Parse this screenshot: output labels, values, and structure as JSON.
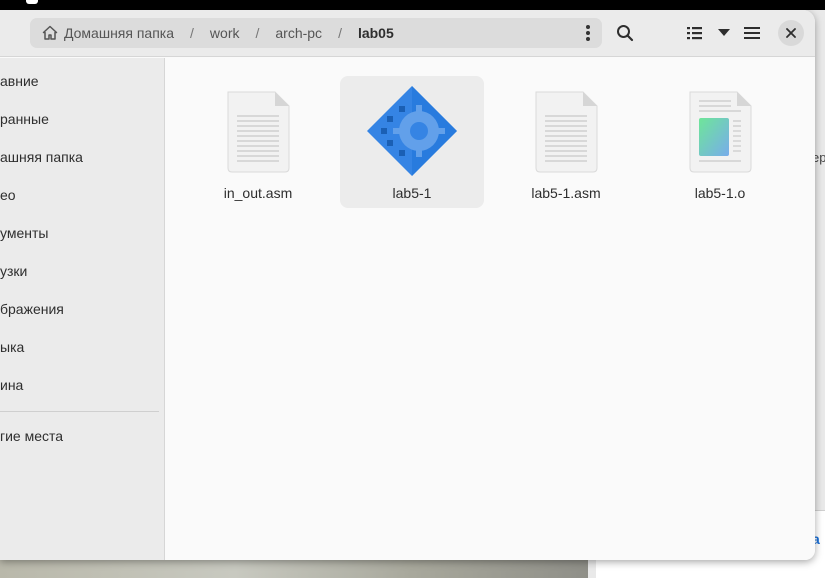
{
  "breadcrumb": {
    "home": "Домашняя папка",
    "items": [
      "work",
      "arch-pc",
      "lab05"
    ],
    "separator": "/"
  },
  "sidebar": {
    "items": [
      {
        "label": "авние"
      },
      {
        "label": "ранные"
      },
      {
        "label": "ашняя папка"
      },
      {
        "label": "ео"
      },
      {
        "label": "ументы"
      },
      {
        "label": "узки"
      },
      {
        "label": "бражения"
      },
      {
        "label": "ыка"
      },
      {
        "label": "ина"
      },
      {
        "label": "гие места"
      }
    ]
  },
  "files": [
    {
      "name": "in_out.asm",
      "type": "text-file-icon",
      "selected": false
    },
    {
      "name": "lab5-1",
      "type": "executable-icon",
      "selected": true
    },
    {
      "name": "lab5-1.asm",
      "type": "text-file-icon",
      "selected": false
    },
    {
      "name": "lab5-1.o",
      "type": "object-file-icon",
      "selected": false
    }
  ],
  "background": {
    "text_a": "ер",
    "text_b": "а"
  },
  "colors": {
    "accent": "#1c71d8",
    "executable_blue": "#3584e4",
    "executable_dark": "#1a5fb4",
    "headerbar": "#ebebeb",
    "content": "#fafafa"
  }
}
